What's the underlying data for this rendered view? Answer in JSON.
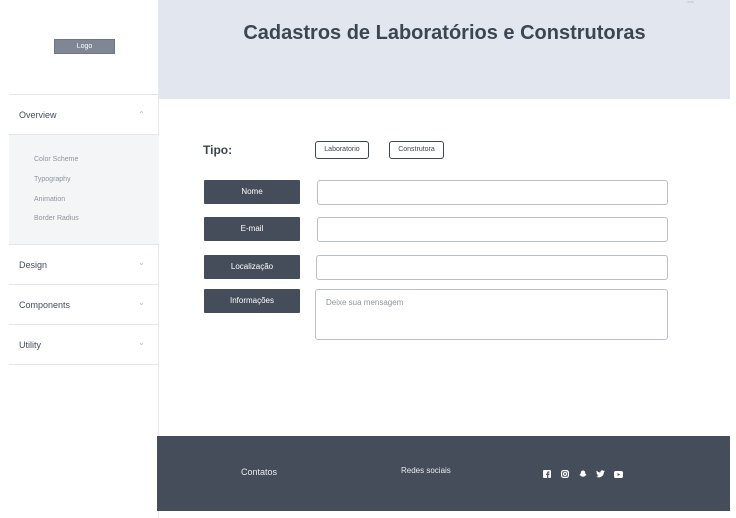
{
  "sidebar": {
    "logo": "Logo",
    "sections": [
      {
        "label": "Overview",
        "chevron": "chevron-up-icon",
        "expanded": true
      },
      {
        "label": "Design",
        "chevron": "chevron-down-icon",
        "expanded": false
      },
      {
        "label": "Components",
        "chevron": "chevron-down-icon",
        "expanded": false
      },
      {
        "label": "Utility",
        "chevron": "chevron-down-icon",
        "expanded": false
      }
    ],
    "overview_items": [
      "Color Scheme",
      "Typography",
      "Animation",
      "Border Radius"
    ]
  },
  "header": {
    "title": "Cadastros de Laboratórios e Construtoras",
    "corner_mark": "~~"
  },
  "form": {
    "tipo_label": "Tipo:",
    "type_options": [
      "Laboratorio",
      "Construtora"
    ],
    "fields": {
      "nome": {
        "label": "Nome",
        "value": ""
      },
      "email": {
        "label": "E-mail",
        "value": ""
      },
      "localizacao": {
        "label": "Localização",
        "value": ""
      },
      "informacoes": {
        "label": "Informações",
        "placeholder": "Deixe sua mensagem"
      }
    }
  },
  "footer": {
    "contacts": "Contatos",
    "social_title": "Redes sociais",
    "social_icons": [
      "facebook-icon",
      "instagram-icon",
      "snapchat-icon",
      "twitter-icon",
      "youtube-icon"
    ]
  },
  "colors": {
    "header_bg": "#e2e6ee",
    "dark": "#454c5a",
    "title": "#3c4552"
  }
}
